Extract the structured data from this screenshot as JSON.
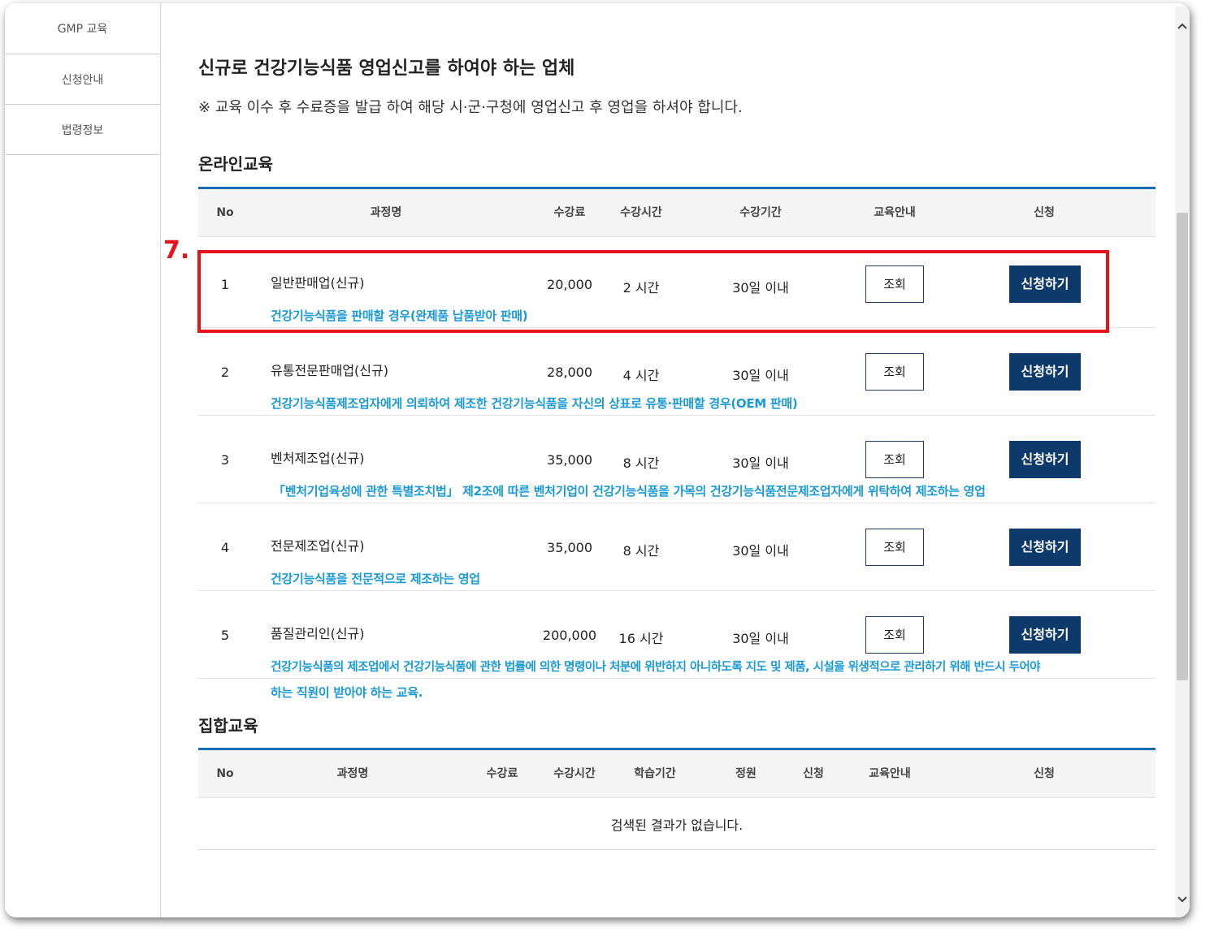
{
  "sidebar": {
    "items": [
      {
        "label": "GMP 교육"
      },
      {
        "label": "신청안내"
      },
      {
        "label": "법령정보"
      }
    ]
  },
  "page": {
    "title": "신규로 건강기능식품 영업신고를 하여야 하는 업체",
    "note": "※ 교육 이수 후 수료증을 발급 하여 해당 시·군·구청에 영업신고 후 영업을 하셔야 합니다."
  },
  "annotation": {
    "marker": "7."
  },
  "online": {
    "title": "온라인교육",
    "headers": {
      "no": "No",
      "course": "과정명",
      "fee": "수강료",
      "hours": "수강시간",
      "period": "수강기간",
      "guide": "교육안내",
      "apply": "신청"
    },
    "rows": [
      {
        "no": "1",
        "name": "일반판매업(신규)",
        "fee": "20,000",
        "hours": "2 시간",
        "period": "30일 이내",
        "view": "조회",
        "apply": "신청하기",
        "desc": "건강기능식품을 판매할 경우(완제품 납품받아 판매)"
      },
      {
        "no": "2",
        "name": "유통전문판매업(신규)",
        "fee": "28,000",
        "hours": "4 시간",
        "period": "30일 이내",
        "view": "조회",
        "apply": "신청하기",
        "desc": "건강기능식품제조업자에게 의뢰하여 제조한 건강기능식품을 자신의 상표로 유통·판매할 경우(OEM 판매)"
      },
      {
        "no": "3",
        "name": "벤처제조업(신규)",
        "fee": "35,000",
        "hours": "8 시간",
        "period": "30일 이내",
        "view": "조회",
        "apply": "신청하기",
        "desc": "「벤처기업육성에 관한 특별조치법」 제2조에 따른 벤처기업이 건강기능식품을 가목의 건강기능식품전문제조업자에게 위탁하여 제조하는 영업"
      },
      {
        "no": "4",
        "name": "전문제조업(신규)",
        "fee": "35,000",
        "hours": "8 시간",
        "period": "30일 이내",
        "view": "조회",
        "apply": "신청하기",
        "desc": "건강기능식품을 전문적으로 제조하는 영업"
      },
      {
        "no": "5",
        "name": "품질관리인(신규)",
        "fee": "200,000",
        "hours": "16 시간",
        "period": "30일 이내",
        "view": "조회",
        "apply": "신청하기",
        "desc": "건강기능식품의 제조업에서 건강기능식품에 관한 법률에 의한 명령이나 처분에 위반하지 아니하도록 지도 및 제품, 시설을 위생적으로 관리하기 위해 반드시 두어야",
        "desc2": "하는 직원이 받아야 하는 교육."
      }
    ]
  },
  "group": {
    "title": "집합교육",
    "headers": {
      "no": "No",
      "course": "과정명",
      "fee": "수강료",
      "hours": "수강시간",
      "period": "학습기간",
      "capacity": "정원",
      "apply1": "신청",
      "guide": "교육안내",
      "apply2": "신청"
    },
    "empty": "검색된 결과가 없습니다."
  },
  "scrollbar": {
    "up_icon": "chevron-up-icon",
    "down_icon": "chevron-down-icon"
  }
}
